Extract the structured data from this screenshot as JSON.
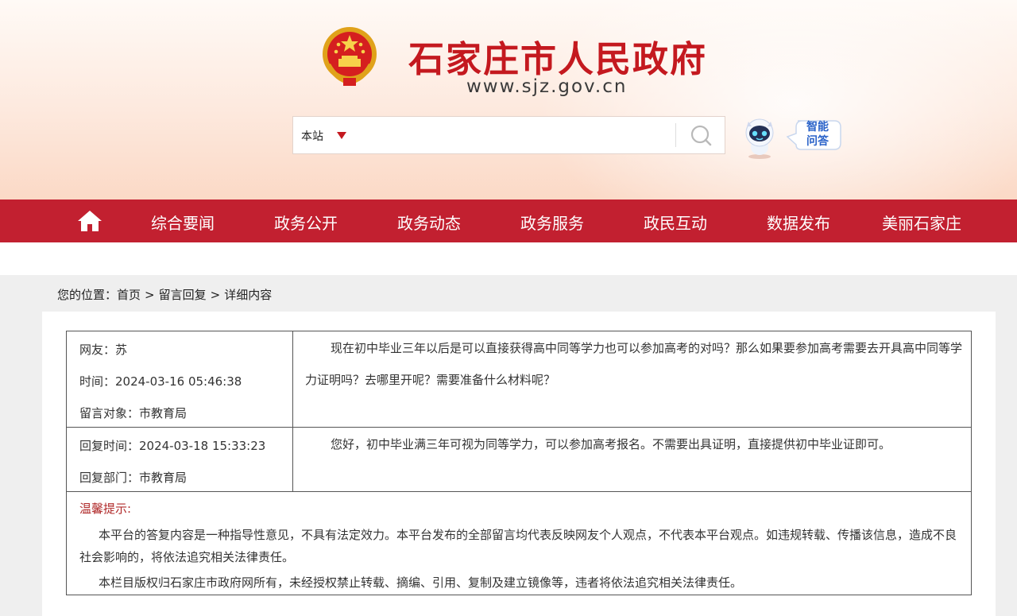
{
  "header": {
    "title": "石家庄市人民政府",
    "url": "www.sjz.gov.cn",
    "emblem_icon": "national-emblem-icon",
    "search": {
      "scope": "本站",
      "placeholder": "",
      "button_icon": "search-icon"
    },
    "assistant": {
      "robot_icon": "robot-icon",
      "label": "智能问答"
    }
  },
  "nav": {
    "home_icon": "home-icon",
    "items": [
      "综合要闻",
      "政务公开",
      "政务动态",
      "政务服务",
      "政民互动",
      "数据发布",
      "美丽石家庄"
    ]
  },
  "breadcrumb": {
    "prefix": "您的位置：",
    "items": [
      "首页",
      "留言回复",
      "详细内容"
    ],
    "separator": ">"
  },
  "message": {
    "user": "网友：苏",
    "time": "时间：2024-03-16 05:46:38",
    "target": "留言对象：市教育局",
    "content": "现在初中毕业三年以后是可以直接获得高中同等学力也可以参加高考的对吗？那么如果要参加高考需要去开具高中同等学力证明吗？去哪里开呢？需要准备什么材料呢？"
  },
  "reply": {
    "time": "回复时间：2024-03-18 15:33:23",
    "department": "回复部门：市教育局",
    "content": "您好，初中毕业满三年可视为同等学力，可以参加高考报名。不需要出具证明，直接提供初中毕业证即可。"
  },
  "tips": {
    "title": "温馨提示:",
    "p1": "本平台的答复内容是一种指导性意见，不具有法定效力。本平台发布的全部留言均代表反映网友个人观点，不代表本平台观点。如违规转载、传播该信息，造成不良社会影响的，将依法追究相关法律责任。",
    "p2": "本栏目版权归石家庄市政府网所有，未经授权禁止转载、摘编、引用、复制及建立镜像等，违者将依法追究相关法律责任。"
  },
  "colors": {
    "brand_red": "#c22030",
    "title_red": "#c4191f",
    "tip_red": "#b02a2a"
  }
}
